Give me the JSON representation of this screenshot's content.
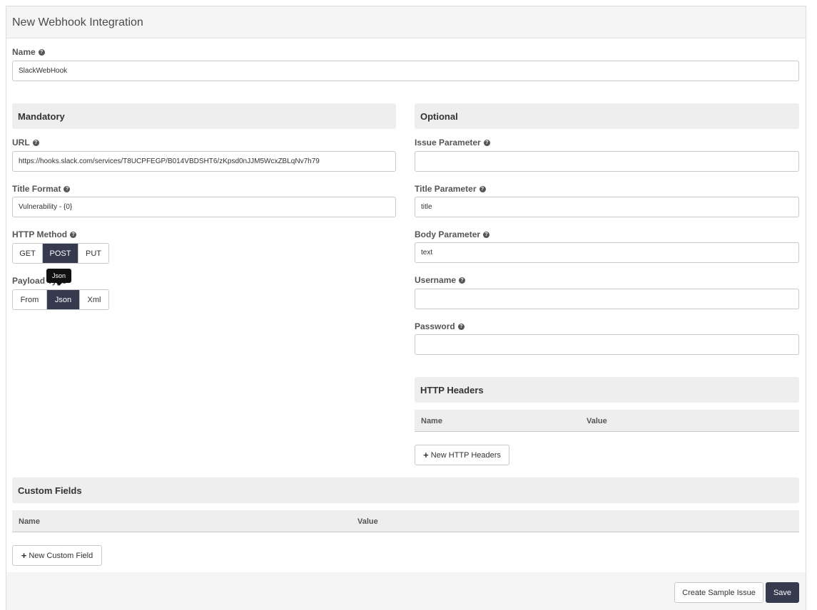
{
  "panel": {
    "title": "New Webhook Integration"
  },
  "name_field": {
    "label": "Name",
    "value": "SlackWebHook"
  },
  "mandatory": {
    "title": "Mandatory",
    "url": {
      "label": "URL",
      "value": "https://hooks.slack.com/services/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"
    },
    "title_format": {
      "label": "Title Format",
      "value": "Vulnerability - {0}"
    },
    "http_method": {
      "label": "HTTP Method",
      "options": [
        "GET",
        "POST",
        "PUT"
      ],
      "selected": "POST"
    },
    "payload_type": {
      "label": "Payload Type",
      "options": [
        "From",
        "Json",
        "Xml"
      ],
      "selected": "Json",
      "tooltip": "Json"
    }
  },
  "optional": {
    "title": "Optional",
    "issue_parameter": {
      "label": "Issue Parameter",
      "value": ""
    },
    "title_parameter": {
      "label": "Title Parameter",
      "value": "title"
    },
    "body_parameter": {
      "label": "Body Parameter",
      "value": "text"
    },
    "username": {
      "label": "Username",
      "value": ""
    },
    "password": {
      "label": "Password",
      "value": ""
    }
  },
  "http_headers": {
    "title": "HTTP Headers",
    "columns": [
      "Name",
      "Value"
    ],
    "add_button": "New HTTP Headers"
  },
  "custom_fields": {
    "title": "Custom Fields",
    "columns": [
      "Name",
      "Value"
    ],
    "add_button": "New Custom Field"
  },
  "footer": {
    "create_sample_label": "Create Sample Issue",
    "save_label": "Save"
  },
  "colors": {
    "accent": "#363a4f",
    "section_bg": "#eeeeef"
  }
}
